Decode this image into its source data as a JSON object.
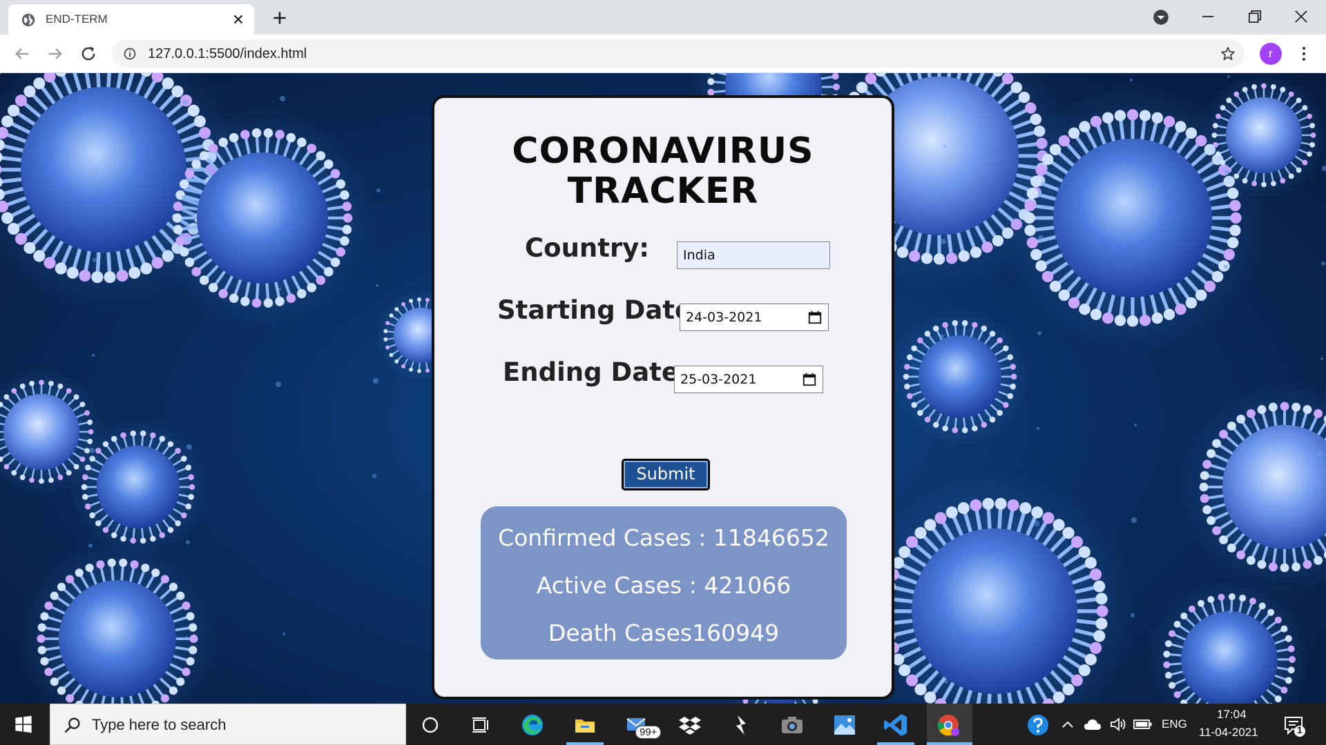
{
  "browser": {
    "tab_title": "END-TERM",
    "url": "127.0.0.1:5500/index.html",
    "profile_initial": "r"
  },
  "page": {
    "title": "CORONAVIRUS TRACKER",
    "country_label": "Country:",
    "country_value": "India",
    "start_label": "Starting Date:",
    "start_value": "24-03-2021",
    "end_label": "Ending Date:",
    "end_value": "25-03-2021",
    "submit_label": "Submit",
    "results": {
      "confirmed": "Confirmed Cases : 11846652",
      "active": "Active Cases : 421066",
      "death": "Death Cases160949"
    }
  },
  "taskbar": {
    "search_placeholder": "Type here to search",
    "mail_badge": "99+",
    "language": "ENG",
    "time": "17:04",
    "date": "11-04-2021",
    "notification_count": "1"
  },
  "colors": {
    "card_bg": "#f1f2f8",
    "results_bg": "#7d94c6",
    "submit_bg": "#1f5294",
    "viewport_bg": "#0a2f63"
  }
}
